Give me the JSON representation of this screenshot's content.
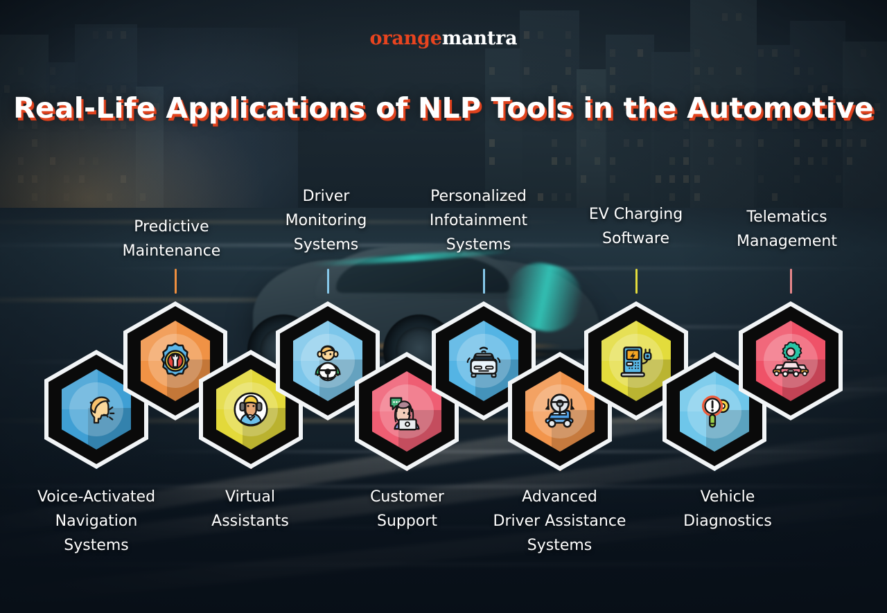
{
  "brand": {
    "name_part1": "orange",
    "name_part2": "mantra",
    "color_primary": "#e8441f",
    "color_secondary": "#ffffff"
  },
  "headline": {
    "text": "Real-Life Applications of NLP Tools in the Automotive",
    "text_color": "#ffffff",
    "shadow_color": "#e8441f"
  },
  "nodes": [
    {
      "id": "voice-activated-navigation-systems",
      "label": "Voice-Activated\nNavigation\nSystems",
      "icon": "speaking-head-icon",
      "hex_color": "#3f9fd4",
      "connector_color": "#4f9ccb",
      "position": "bottom"
    },
    {
      "id": "predictive-maintenance",
      "label": "Predictive\nMaintenance",
      "icon": "gear-wrench-icon",
      "hex_color": "#f09245",
      "connector_color": "#ef8f3f",
      "position": "top"
    },
    {
      "id": "virtual-assistants",
      "label": "Virtual\nAssistants",
      "icon": "headset-agent-icon",
      "hex_color": "#e3d93a",
      "connector_color": "#e8878b",
      "position": "bottom"
    },
    {
      "id": "driver-monitoring-systems",
      "label": "Driver\nMonitoring\nSystems",
      "icon": "driver-steering-icon",
      "hex_color": "#7cc6ea",
      "connector_color": "#86c8ea",
      "position": "top"
    },
    {
      "id": "customer-support",
      "label": "Customer\nSupport",
      "icon": "support-chat-icon",
      "hex_color": "#ef5e73",
      "connector_color": "#e8878b",
      "position": "bottom"
    },
    {
      "id": "personalized-infotainment-systems",
      "label": "Personalized\nInfotainment\nSystems",
      "icon": "connected-car-icon",
      "hex_color": "#54b4e4",
      "connector_color": "#86c8ea",
      "position": "top"
    },
    {
      "id": "advanced-driver-assistance-systems",
      "label": "Advanced\nDriver Assistance\nSystems",
      "icon": "steering-wheel-car-icon",
      "hex_color": "#f2954c",
      "connector_color": "#ef8f3f",
      "position": "bottom"
    },
    {
      "id": "ev-charging-software",
      "label": "EV Charging\nSoftware",
      "icon": "ev-charger-icon",
      "hex_color": "#e3dc3c",
      "connector_color": "#e3dc3c",
      "position": "top"
    },
    {
      "id": "vehicle-diagnostics",
      "label": "Vehicle\nDiagnostics",
      "icon": "magnifier-alert-gear-icon",
      "hex_color": "#6ec6ea",
      "connector_color": "#5aa8d6",
      "position": "bottom"
    },
    {
      "id": "telematics-management",
      "label": "Telematics\nManagement",
      "icon": "fleet-gear-icon",
      "hex_color": "#ef5268",
      "connector_color": "#e8878b",
      "position": "top"
    }
  ]
}
